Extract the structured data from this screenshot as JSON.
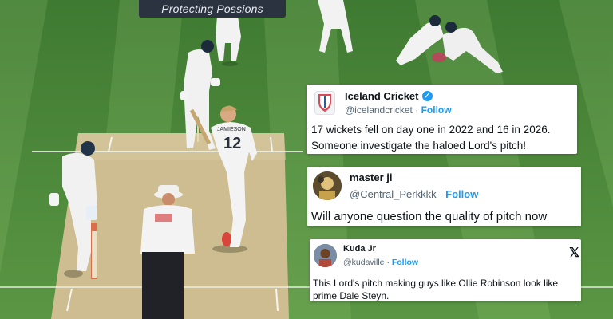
{
  "banner": {
    "text": "Protecting Possions"
  },
  "jersey": {
    "name": "JAMIESON",
    "number": "12"
  },
  "tweets": [
    {
      "name": "Iceland Cricket",
      "handle": "@icelandcricket",
      "follow": "Follow",
      "verified": true,
      "avatar_icon": "iceland-cricket-logo-icon",
      "text_lines": [
        "17 wickets fell on day one in 2022 and 16 in 2026.",
        "Someone investigate the haloed Lord's pitch!"
      ]
    },
    {
      "name": "master ji",
      "handle": "@Central_Perkkkk",
      "follow": "Follow",
      "text_lines": [
        "Will anyone question the quality of pitch now"
      ]
    },
    {
      "name": "Kuda Jr",
      "handle": "@kudaville",
      "follow": "Follow",
      "platform_icon": "x-logo-icon",
      "text_lines": [
        "This Lord's pitch making guys like Ollie Robinson look like",
        "prime Dale Steyn."
      ]
    }
  ],
  "separator": "·",
  "colors": {
    "grass": "#4f8a3c",
    "pitch": "#cbbb8d",
    "follow": "#1d9bf0",
    "verified": "#1d9bf0"
  }
}
